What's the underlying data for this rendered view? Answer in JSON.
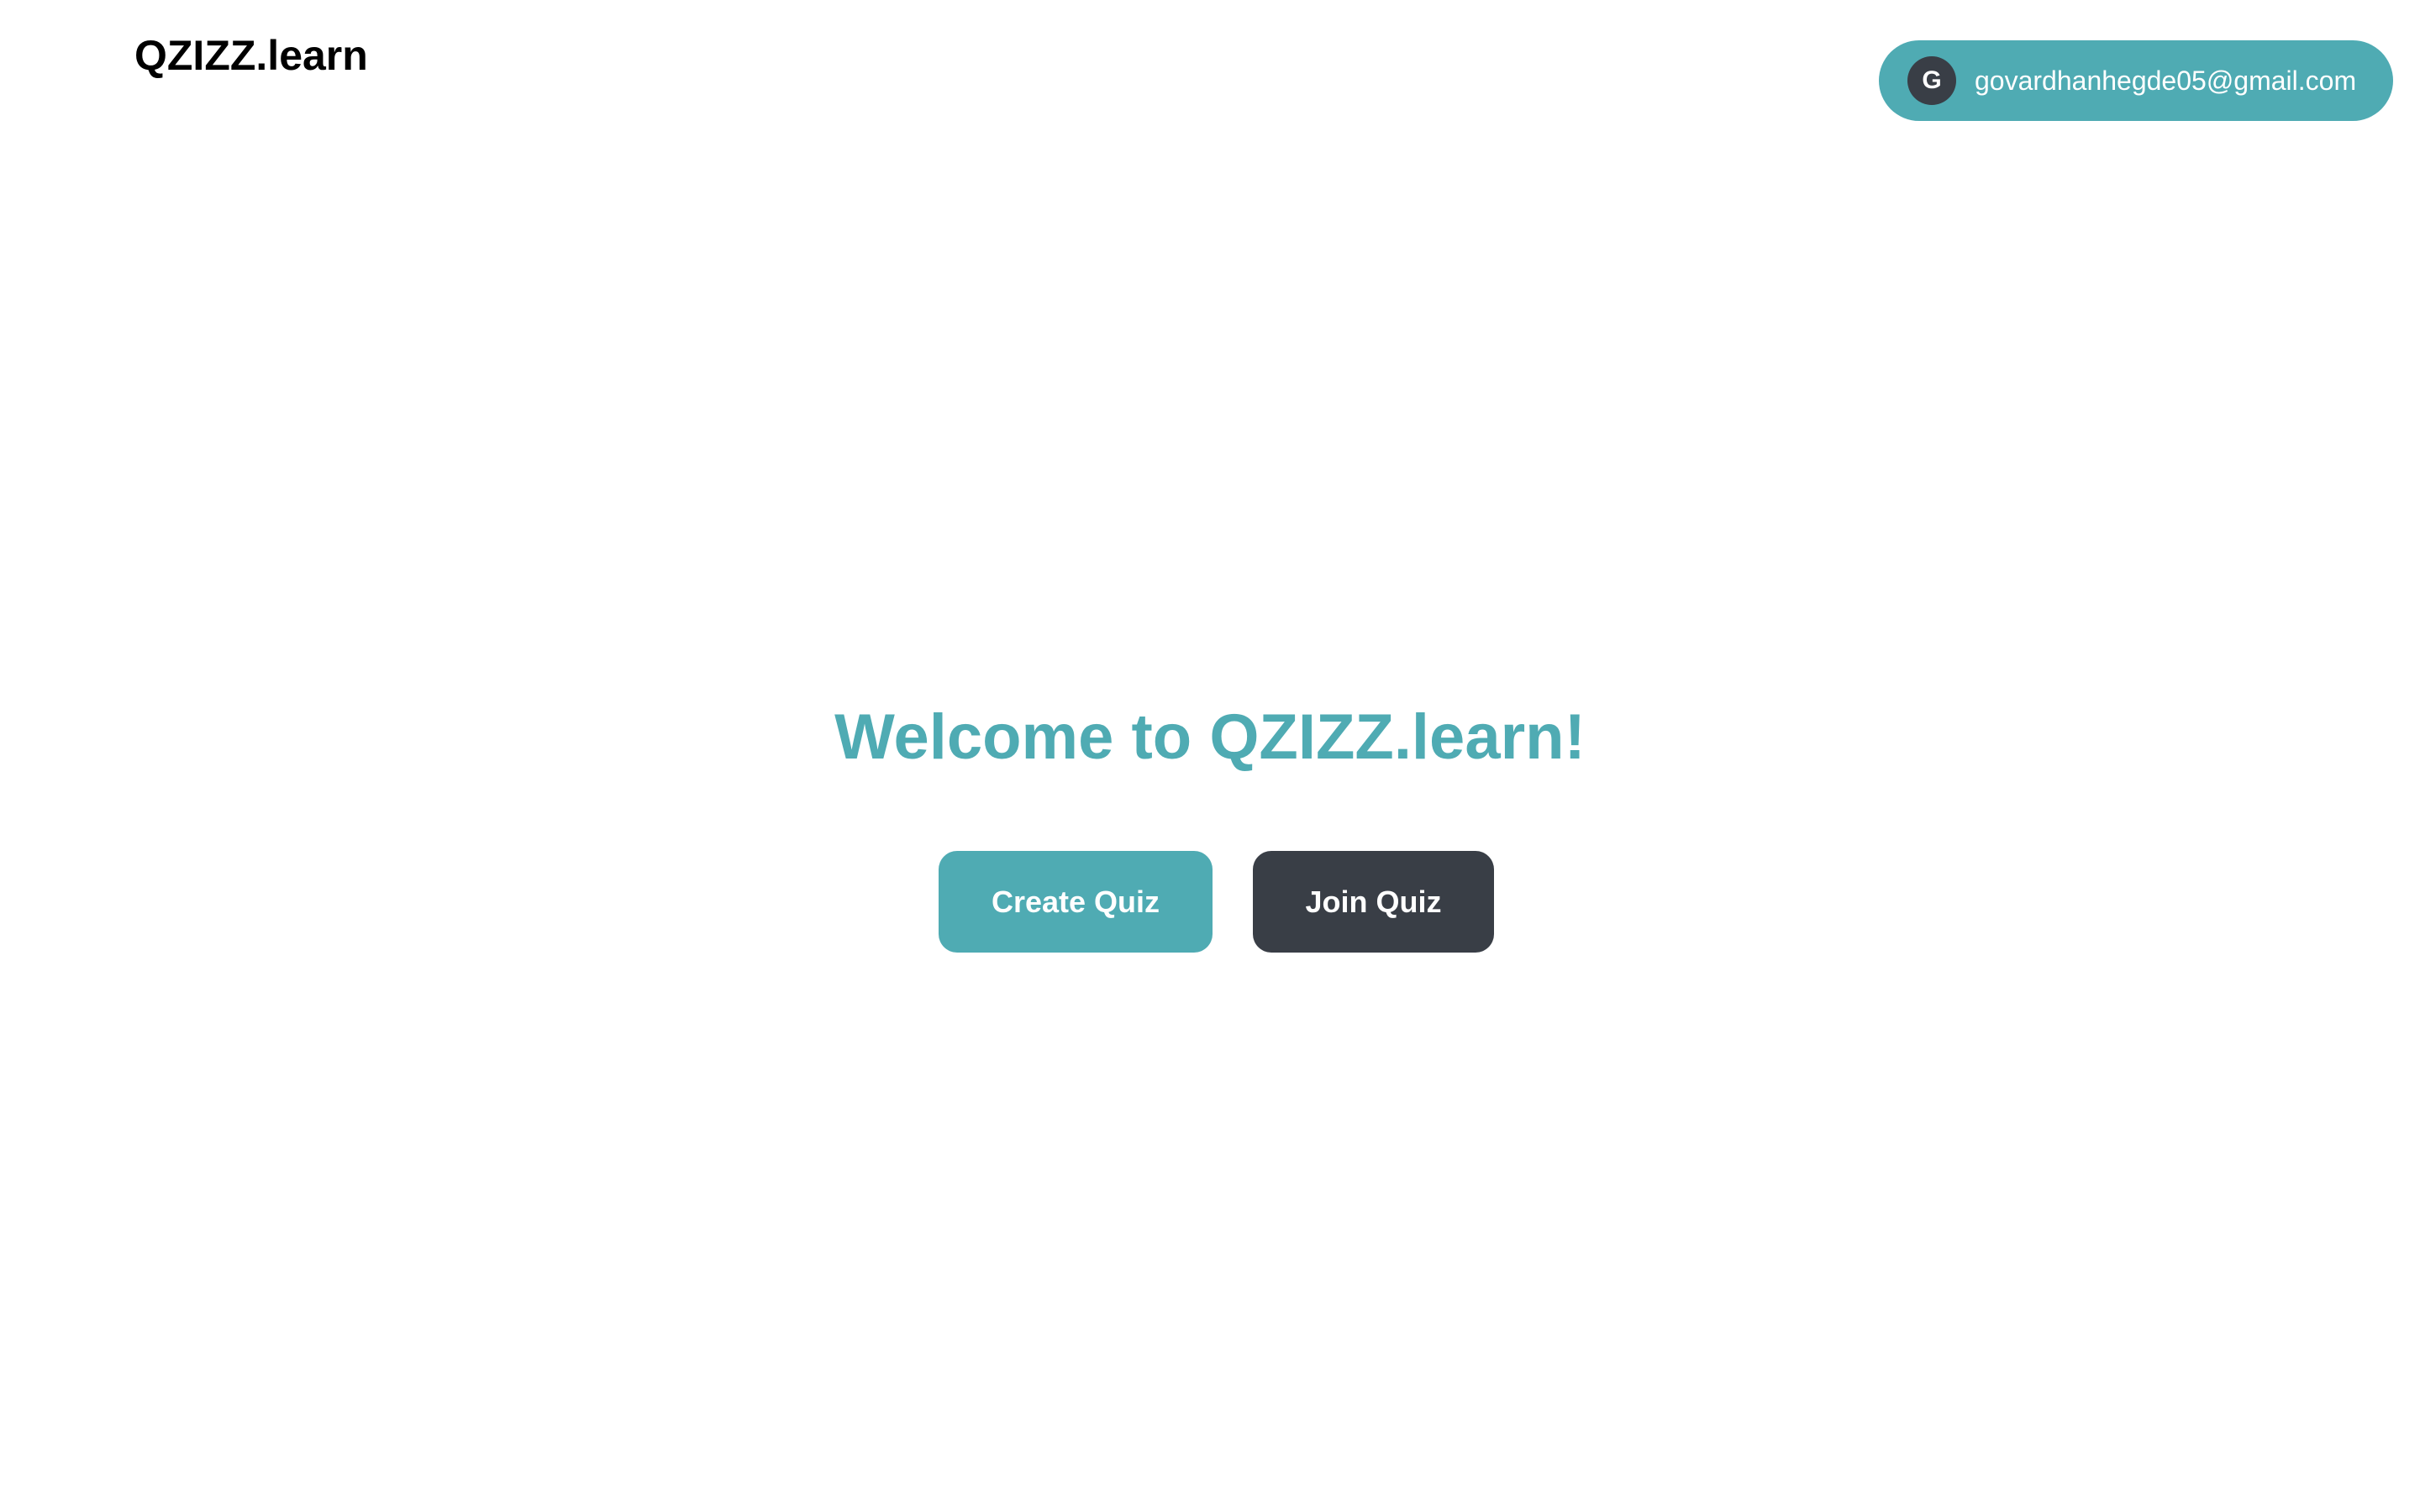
{
  "header": {
    "brand": "QZIZZ.learn"
  },
  "user": {
    "avatar_initial": "G",
    "email": "govardhanhegde05@gmail.com"
  },
  "main": {
    "welcome": "Welcome to QZIZZ.learn!",
    "create_label": "Create Quiz",
    "join_label": "Join Quiz"
  },
  "colors": {
    "accent": "#4FABB3",
    "dark": "#393E46",
    "text": "#000000",
    "background": "#FFFFFF"
  }
}
